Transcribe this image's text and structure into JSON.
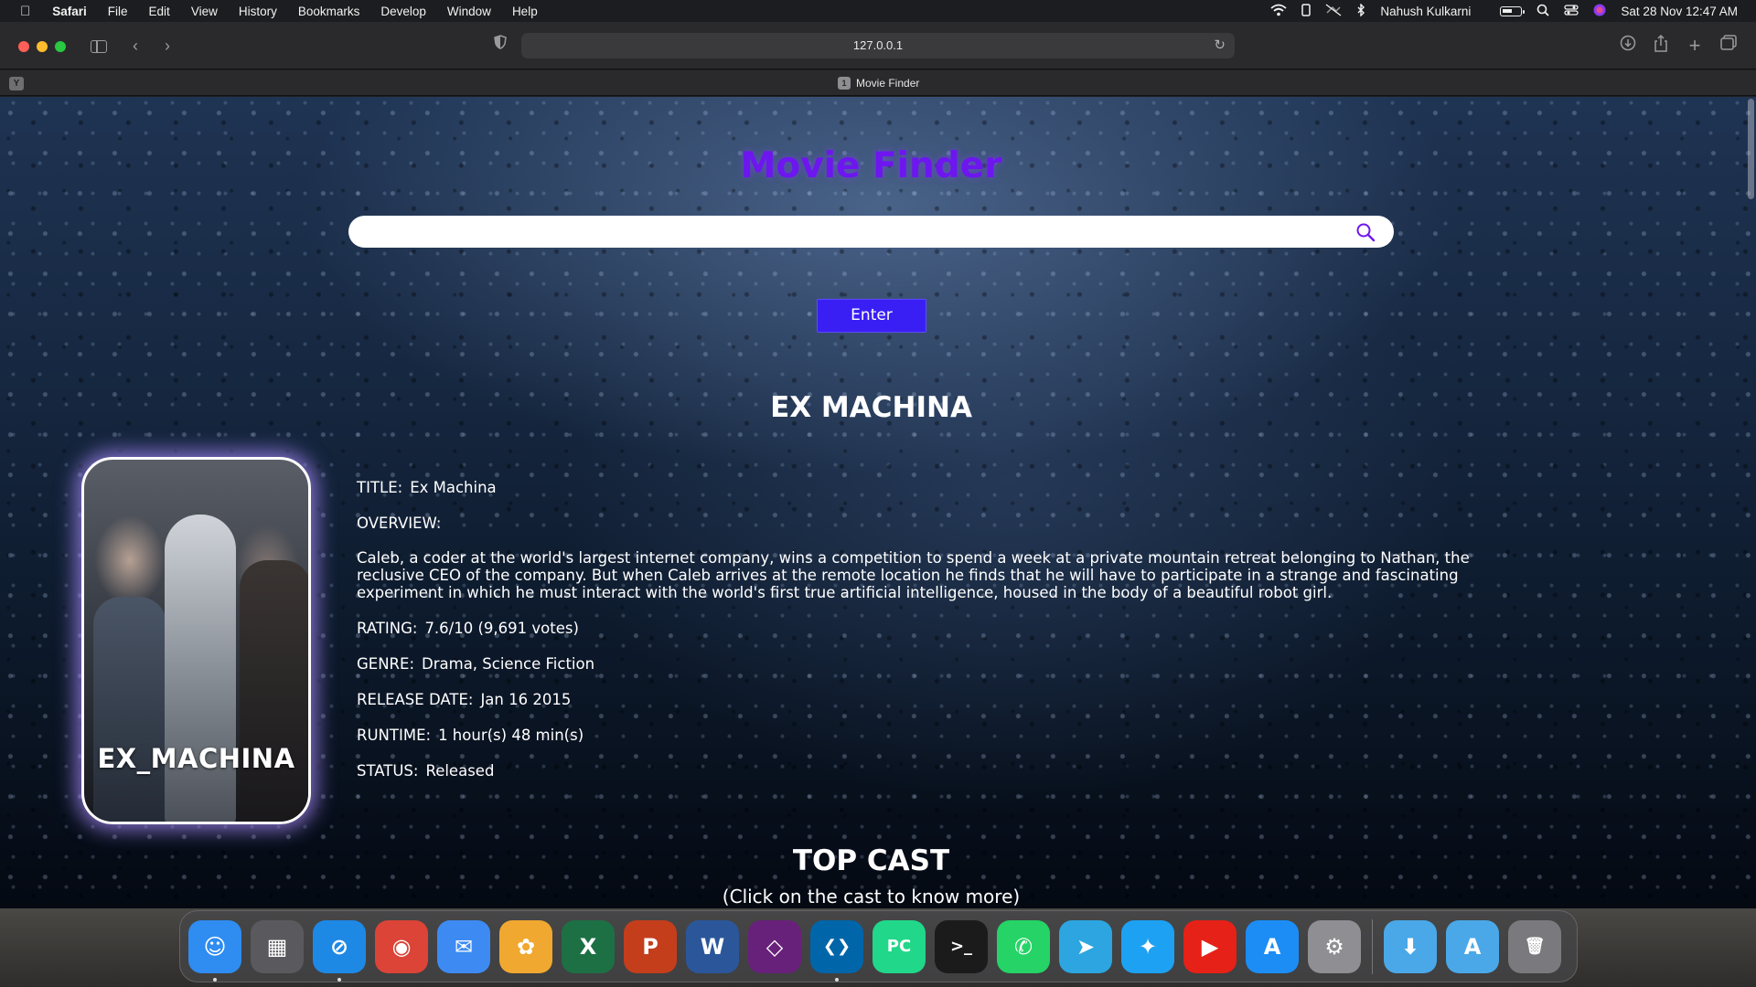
{
  "menubar": {
    "apple": "",
    "app_name": "Safari",
    "menus": [
      "File",
      "Edit",
      "View",
      "History",
      "Bookmarks",
      "Develop",
      "Window",
      "Help"
    ],
    "user": "Nahush Kulkarni",
    "datetime": "Sat 28 Nov  12:47 AM"
  },
  "browser": {
    "url": "127.0.0.1",
    "pinned_tab_letter": "Y",
    "tab": {
      "favicon_text": "1",
      "title": "Movie Finder"
    }
  },
  "page": {
    "app_title": "Movie Finder",
    "search": {
      "value": "",
      "placeholder": ""
    },
    "enter_label": "Enter",
    "movie_heading": "EX MACHINA",
    "poster_title": "EX_MACHINA",
    "details": {
      "title_label": "TITLE:",
      "title_value": "Ex Machina",
      "overview_label": "OVERVIEW:",
      "overview_text": "Caleb, a coder at the world's largest internet company, wins a competition to spend a week at a private mountain retreat belonging to Nathan, the reclusive CEO of the company. But when Caleb arrives at the remote location he finds that he will have to participate in a strange and fascinating experiment in which he must interact with the world's first true artificial intelligence, housed in the body of a beautiful robot girl.",
      "rating_label": "RATING:",
      "rating_value": "7.6/10 (9,691 votes)",
      "genre_label": "GENRE:",
      "genre_value": "Drama, Science Fiction",
      "release_label": "RELEASE DATE:",
      "release_value": "Jan 16 2015",
      "runtime_label": "RUNTIME:",
      "runtime_value": "1 hour(s) 48 min(s)",
      "status_label": "STATUS:",
      "status_value": "Released"
    },
    "top_cast_heading": "TOP CAST",
    "top_cast_sub": "(Click on the cast to know more)"
  },
  "colors": {
    "title_purple": "#6d16f0",
    "enter_button": "#3a1ff5"
  },
  "dock": {
    "apps": [
      {
        "name": "finder-icon",
        "glyph": "☺",
        "bg": "#2f8cf0",
        "running": true
      },
      {
        "name": "launchpad-icon",
        "glyph": "▦",
        "bg": "#5a5a5e",
        "running": false
      },
      {
        "name": "safari-icon",
        "glyph": "⊘",
        "bg": "#1e88e5",
        "running": true
      },
      {
        "name": "chrome-icon",
        "glyph": "◉",
        "bg": "#db4437",
        "running": false
      },
      {
        "name": "mail-icon",
        "glyph": "✉",
        "bg": "#3d8bf2",
        "running": false
      },
      {
        "name": "photos-icon",
        "glyph": "✿",
        "bg": "#f0a830",
        "running": false
      },
      {
        "name": "excel-icon",
        "glyph": "X",
        "bg": "#1d7044",
        "running": false
      },
      {
        "name": "powerpoint-icon",
        "glyph": "P",
        "bg": "#c43e1c",
        "running": false
      },
      {
        "name": "word-icon",
        "glyph": "W",
        "bg": "#2b579a",
        "running": false
      },
      {
        "name": "visual-studio-icon",
        "glyph": "◇",
        "bg": "#68217a",
        "running": false
      },
      {
        "name": "vscode-icon",
        "glyph": "❮❯",
        "bg": "#0065a9",
        "running": true
      },
      {
        "name": "pycharm-icon",
        "glyph": "PC",
        "bg": "#21d789",
        "running": false
      },
      {
        "name": "terminal-icon",
        "glyph": ">_",
        "bg": "#1b1b1b",
        "running": false
      },
      {
        "name": "whatsapp-icon",
        "glyph": "✆",
        "bg": "#25d366",
        "running": false
      },
      {
        "name": "telegram-icon",
        "glyph": "➤",
        "bg": "#2ca5e0",
        "running": false
      },
      {
        "name": "twitter-icon",
        "glyph": "✦",
        "bg": "#1da1f2",
        "running": false
      },
      {
        "name": "youtube-icon",
        "glyph": "▶",
        "bg": "#e62117",
        "running": false
      },
      {
        "name": "app-store-icon",
        "glyph": "A",
        "bg": "#1c8df5",
        "running": false
      },
      {
        "name": "system-preferences-icon",
        "glyph": "⚙",
        "bg": "#8e8e93",
        "running": false
      }
    ],
    "folders": [
      {
        "name": "downloads-folder-icon",
        "glyph": "⬇",
        "bg": "#4aa8e8"
      },
      {
        "name": "applications-folder-icon",
        "glyph": "A",
        "bg": "#4aa8e8"
      },
      {
        "name": "trash-icon",
        "glyph": "🗑",
        "bg": "#7a7a7e"
      }
    ]
  }
}
